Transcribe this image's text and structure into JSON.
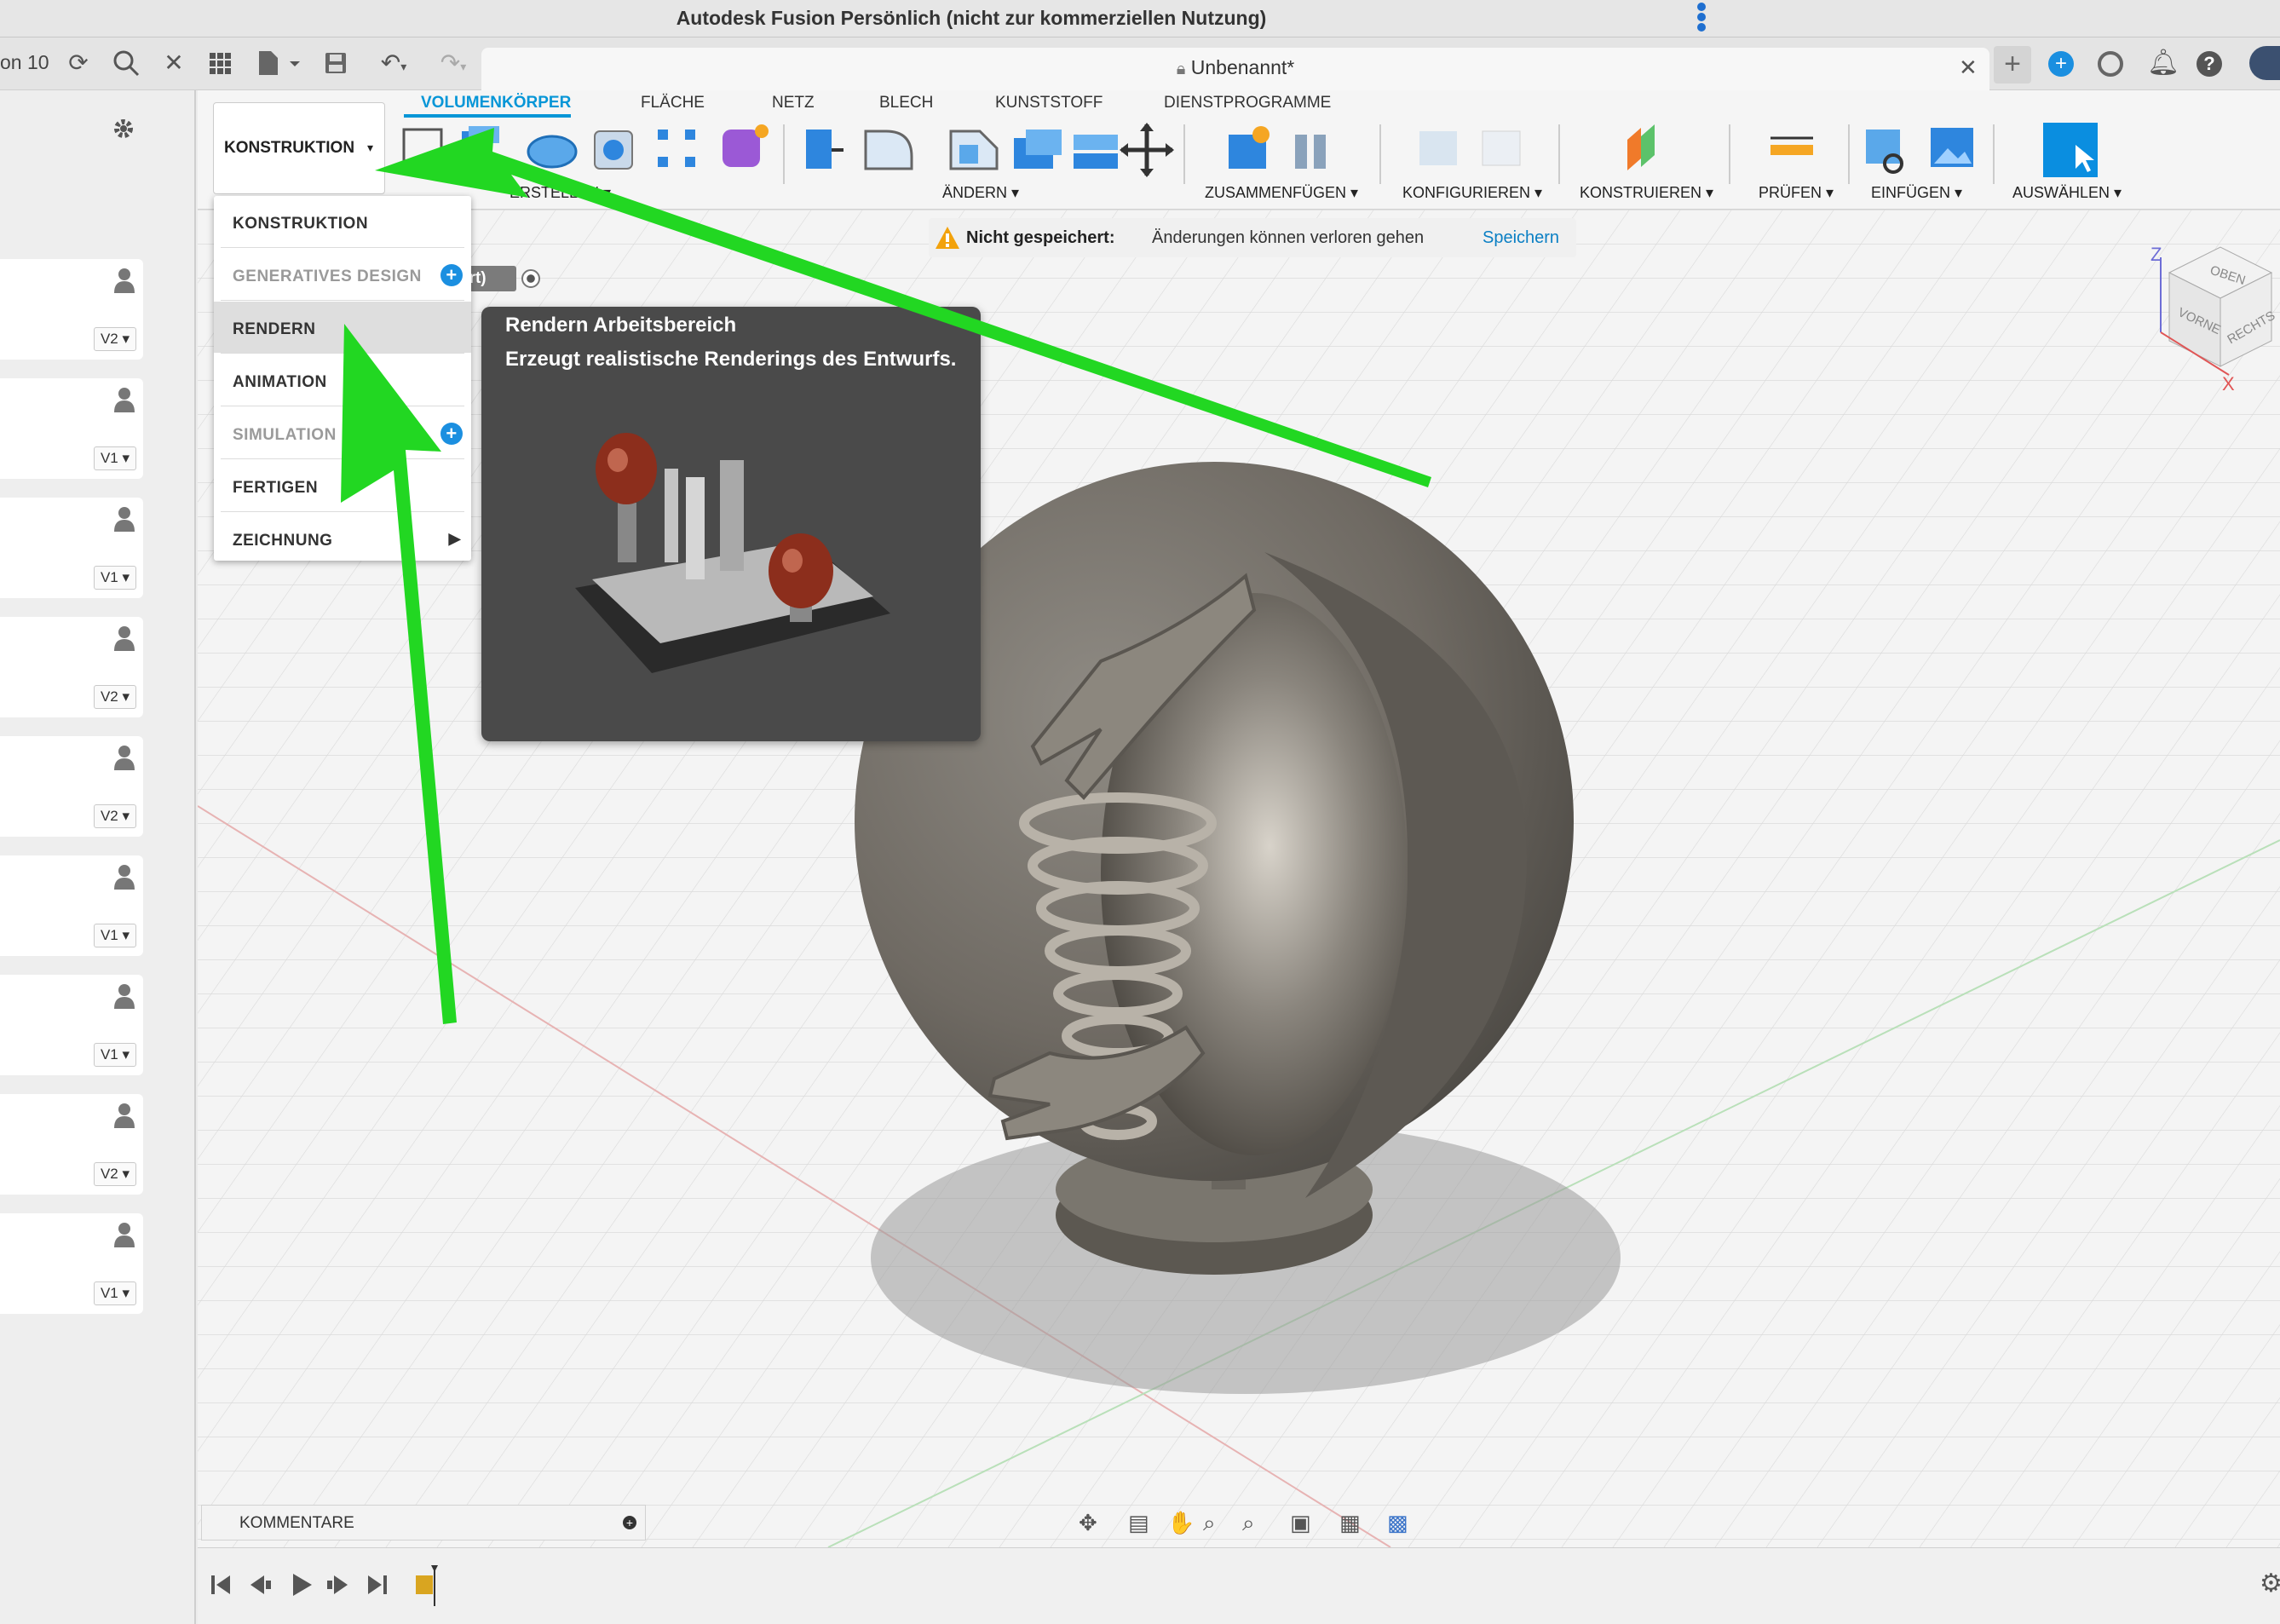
{
  "window": {
    "title": "Autodesk Fusion Persönlich (nicht zur kommerziellen Nutzung)"
  },
  "topbar": {
    "left_fragment": "on 10",
    "document_title": "Unbenannt*"
  },
  "ribbon": {
    "workspace_button": "KONSTRUKTION",
    "tabs": [
      "VOLUMENKÖRPER",
      "FLÄCHE",
      "NETZ",
      "BLECH",
      "KUNSTSTOFF",
      "DIENSTPROGRAMME"
    ],
    "groups": [
      "ERSTELLEN",
      "ÄNDERN",
      "ZUSAMMENFÜGEN",
      "KONFIGURIEREN",
      "KONSTRUIEREN",
      "PRÜFEN",
      "EINFÜGEN",
      "AUSWÄHLEN"
    ]
  },
  "workspace_menu": {
    "items": [
      "KONSTRUKTION",
      "GENERATIVES DESIGN",
      "RENDERN",
      "ANIMATION",
      "SIMULATION",
      "FERTIGEN",
      "ZEICHNUNG"
    ],
    "highlighted": "RENDERN"
  },
  "tooltip": {
    "title": "Rendern Arbeitsbereich",
    "description": "Erzeugt realistische Renderings des Entwurfs."
  },
  "warning": {
    "label": "Nicht gespeichert:",
    "message": "Änderungen können verloren gehen",
    "action": "Speichern"
  },
  "browser_fragment": "ert)",
  "left_panel": {
    "versions": [
      "V2",
      "V1",
      "V1",
      "V2",
      "V2",
      "V1",
      "V1",
      "V2",
      "V1"
    ]
  },
  "viewcube": {
    "top": "OBEN",
    "front": "VORNE",
    "right": "RECHTS",
    "axis_z": "Z",
    "axis_x": "X"
  },
  "comments": {
    "label": "KOMMENTARE"
  },
  "colors": {
    "accent": "#0696d7",
    "annotation_arrow": "#22d722",
    "tooltip_bg": "#4a4a4a"
  }
}
